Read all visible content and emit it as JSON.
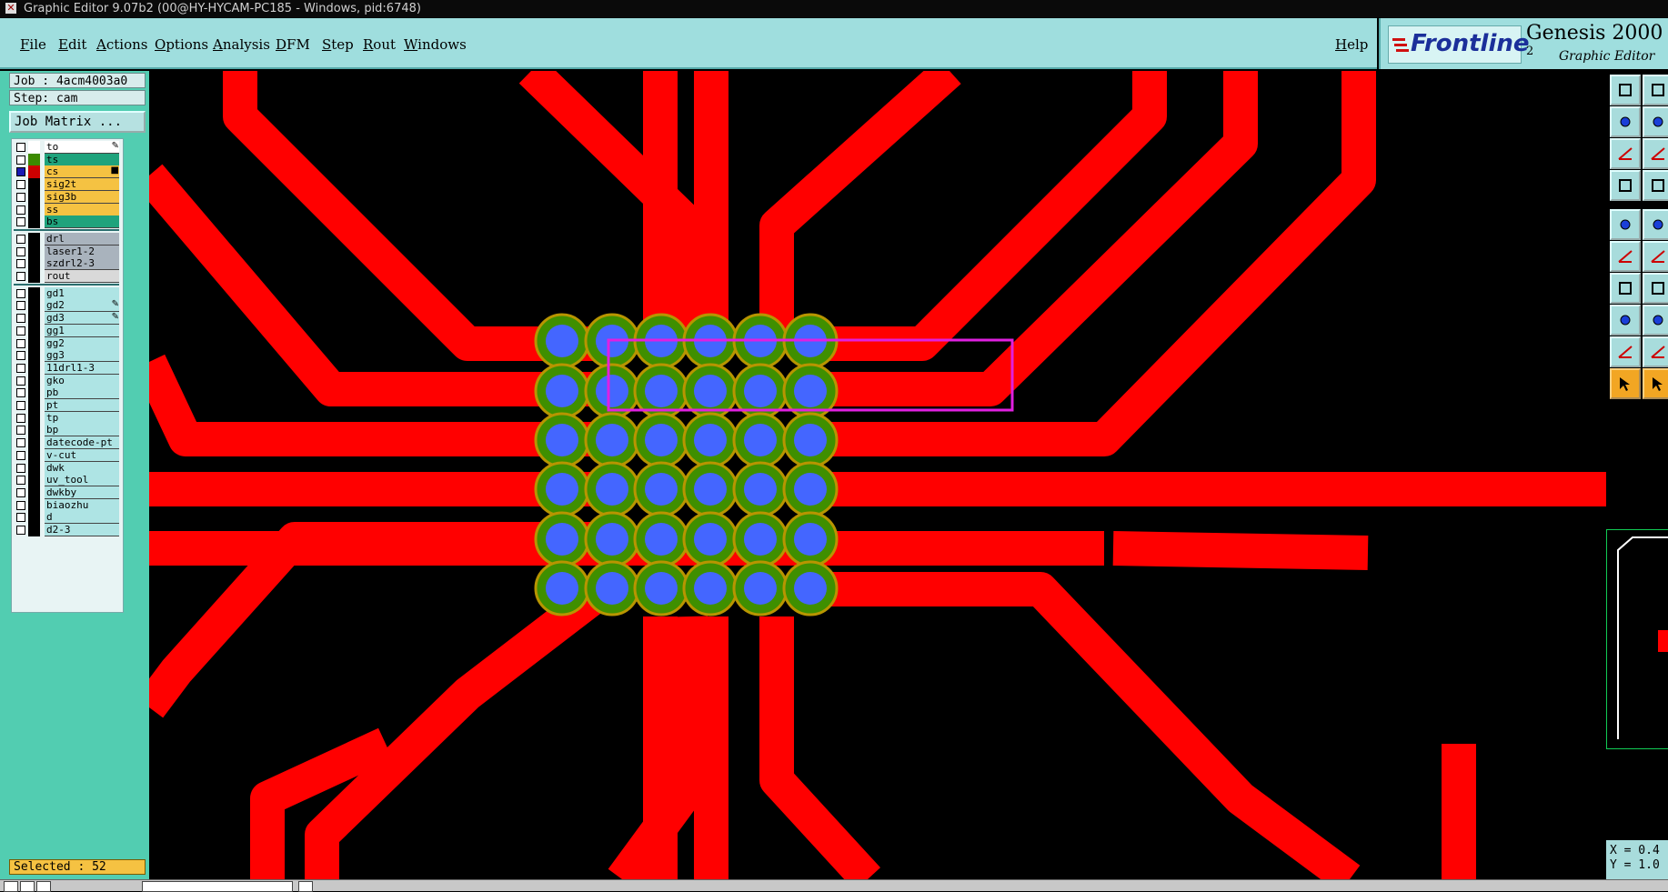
{
  "window": {
    "title": "Graphic Editor 9.07b2 (00@HY-HYCAM-PC185 - Windows, pid:6748)"
  },
  "menu": {
    "items": [
      "File",
      "Edit",
      "Actions",
      "Options",
      "Analysis",
      "DFM",
      "Step",
      "Rout",
      "Windows"
    ],
    "help": "Help"
  },
  "brand": {
    "logo": "Frontline",
    "product": "Genesis 2000",
    "product_sup": "2",
    "subtitle": "Graphic Editor"
  },
  "job": {
    "job_label": "Job : 4acm4003a0",
    "step_label": "Step: cam",
    "matrix_button": "Job Matrix ..."
  },
  "layers": [
    {
      "name": "to",
      "color": "#ffffff",
      "swatch": "#ffffff",
      "checked": false,
      "marker": "✎"
    },
    {
      "name": "ts",
      "color": "#1fa37c",
      "swatch": "#3c8a00",
      "checked": false,
      "marker": ""
    },
    {
      "name": "cs",
      "color": "#f5c242",
      "swatch": "#cc0000",
      "checked": true,
      "marker": "■"
    },
    {
      "name": "sig2t",
      "color": "#f5c242",
      "swatch": "",
      "checked": false,
      "marker": ""
    },
    {
      "name": "sig3b",
      "color": "#f5c242",
      "swatch": "",
      "checked": false,
      "marker": ""
    },
    {
      "name": "ss",
      "color": "#f5c242",
      "swatch": "",
      "checked": false,
      "marker": ""
    },
    {
      "name": "bs",
      "color": "#1fa37c",
      "swatch": "",
      "checked": false,
      "marker": ""
    },
    {
      "name": "drl",
      "color": "#a9b3bd",
      "swatch": "",
      "checked": false,
      "marker": ""
    },
    {
      "name": "laser1-2",
      "color": "#a9b3bd",
      "swatch": "",
      "checked": false,
      "marker": ""
    },
    {
      "name": "szdrl2-3",
      "color": "#a9b3bd",
      "swatch": "",
      "checked": false,
      "marker": ""
    },
    {
      "name": "rout",
      "color": "#d9d9d9",
      "swatch": "",
      "checked": false,
      "marker": ""
    },
    {
      "name": "gd1",
      "color": "#aee4e4",
      "swatch": "",
      "checked": false,
      "marker": ""
    },
    {
      "name": "gd2",
      "color": "#aee4e4",
      "swatch": "",
      "checked": false,
      "marker": "✎"
    },
    {
      "name": "gd3",
      "color": "#aee4e4",
      "swatch": "",
      "checked": false,
      "marker": "✎"
    },
    {
      "name": "gg1",
      "color": "#aee4e4",
      "swatch": "",
      "checked": false,
      "marker": ""
    },
    {
      "name": "gg2",
      "color": "#aee4e4",
      "swatch": "",
      "checked": false,
      "marker": ""
    },
    {
      "name": "gg3",
      "color": "#aee4e4",
      "swatch": "",
      "checked": false,
      "marker": ""
    },
    {
      "name": "11drl1-3",
      "color": "#aee4e4",
      "swatch": "",
      "checked": false,
      "marker": ""
    },
    {
      "name": "gko",
      "color": "#aee4e4",
      "swatch": "",
      "checked": false,
      "marker": ""
    },
    {
      "name": "pb",
      "color": "#aee4e4",
      "swatch": "",
      "checked": false,
      "marker": ""
    },
    {
      "name": "pt",
      "color": "#aee4e4",
      "swatch": "",
      "checked": false,
      "marker": ""
    },
    {
      "name": "tp",
      "color": "#aee4e4",
      "swatch": "",
      "checked": false,
      "marker": ""
    },
    {
      "name": "bp",
      "color": "#aee4e4",
      "swatch": "",
      "checked": false,
      "marker": ""
    },
    {
      "name": "datecode-pt",
      "color": "#aee4e4",
      "swatch": "",
      "checked": false,
      "marker": ""
    },
    {
      "name": "v-cut",
      "color": "#aee4e4",
      "swatch": "",
      "checked": false,
      "marker": ""
    },
    {
      "name": "dwk",
      "color": "#aee4e4",
      "swatch": "",
      "checked": false,
      "marker": ""
    },
    {
      "name": "uv_tool",
      "color": "#aee4e4",
      "swatch": "",
      "checked": false,
      "marker": ""
    },
    {
      "name": "dwkby",
      "color": "#aee4e4",
      "swatch": "",
      "checked": false,
      "marker": ""
    },
    {
      "name": "biaozhu",
      "color": "#aee4e4",
      "swatch": "",
      "checked": false,
      "marker": ""
    },
    {
      "name": "d",
      "color": "#aee4e4",
      "swatch": "",
      "checked": false,
      "marker": ""
    },
    {
      "name": "d2-3",
      "color": "#aee4e4",
      "swatch": "",
      "checked": false,
      "marker": ""
    }
  ],
  "status": {
    "selected": "Selected : 52",
    "x": "X = 0.4",
    "y": "Y = 1.0"
  },
  "colors": {
    "menu_bg": "#9fdede",
    "panel_bg": "#52cdb1",
    "trace": "#ff0000",
    "pad_ring": "#3f8f00",
    "pad_ring_edge": "#b89500",
    "pad_fill": "#4466ff",
    "selection_box": "#e020e0"
  },
  "icons": {
    "tools": [
      "layer-up-icon",
      "layer-down-icon",
      "pan-left-icon",
      "pan-right-icon",
      "zoom-fit-icon",
      "zoom-center-icon",
      "measure-icon",
      "grid-icon",
      "snap-icon",
      "line-shape-icon",
      "net-icon",
      "cross-icon",
      "angle-icon",
      "slash-icon",
      "pad-icon",
      "dimension-icon",
      "triangle-icon",
      "arc-icon",
      "select-pointer-icon",
      "select-arrow-icon"
    ]
  }
}
